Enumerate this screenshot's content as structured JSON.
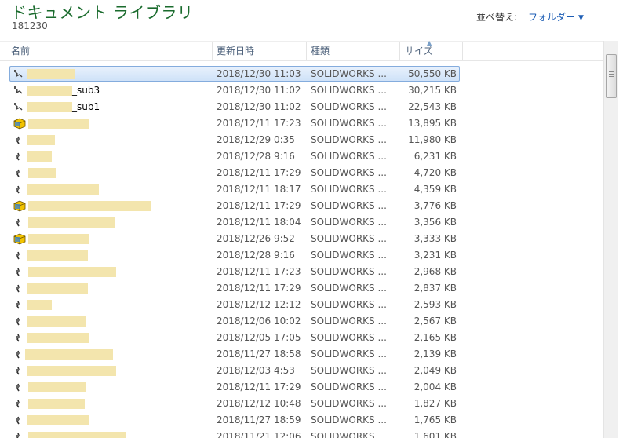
{
  "library": {
    "title": "ドキュメント ライブラリ",
    "subtitle": "181230",
    "arrange_label": "並べ替え:",
    "arrange_value": "フォルダー"
  },
  "columns": {
    "name": "名前",
    "date": "更新日時",
    "type": "種類",
    "size": "サイズ"
  },
  "files": [
    {
      "name_suffix": "",
      "date": "2018/12/30 11:03",
      "type": "SOLIDWORKS ...",
      "size": "50,550 KB",
      "icon": "assembly-icon",
      "selected": true
    },
    {
      "name_suffix": "_sub3",
      "date": "2018/12/30 11:02",
      "type": "SOLIDWORKS ...",
      "size": "30,215 KB",
      "icon": "assembly-icon"
    },
    {
      "name_suffix": "_sub1",
      "date": "2018/12/30 11:02",
      "type": "SOLIDWORKS ...",
      "size": "22,543 KB",
      "icon": "assembly-icon"
    },
    {
      "name_suffix": "",
      "date": "2018/12/11 17:23",
      "type": "SOLIDWORKS ...",
      "size": "13,895 KB",
      "icon": "solidworks-icon"
    },
    {
      "name_suffix": "",
      "date": "2018/12/29 0:35",
      "type": "SOLIDWORKS ...",
      "size": "11,980 KB",
      "icon": "part-icon"
    },
    {
      "name_suffix": "",
      "date": "2018/12/28 9:16",
      "type": "SOLIDWORKS ...",
      "size": "6,231 KB",
      "icon": "part-icon"
    },
    {
      "name_suffix": "",
      "date": "2018/12/11 17:29",
      "type": "SOLIDWORKS ...",
      "size": "4,720 KB",
      "icon": "part-icon"
    },
    {
      "name_suffix": "",
      "date": "2018/12/11 18:17",
      "type": "SOLIDWORKS ...",
      "size": "4,359 KB",
      "icon": "part-icon"
    },
    {
      "name_suffix": "",
      "date": "2018/12/11 17:29",
      "type": "SOLIDWORKS ...",
      "size": "3,776 KB",
      "icon": "solidworks-icon"
    },
    {
      "name_suffix": "",
      "date": "2018/12/11 18:04",
      "type": "SOLIDWORKS ...",
      "size": "3,356 KB",
      "icon": "part-icon"
    },
    {
      "name_suffix": "",
      "date": "2018/12/26 9:52",
      "type": "SOLIDWORKS ...",
      "size": "3,333 KB",
      "icon": "solidworks-icon"
    },
    {
      "name_suffix": "",
      "date": "2018/12/28 9:16",
      "type": "SOLIDWORKS ...",
      "size": "3,231 KB",
      "icon": "part-icon"
    },
    {
      "name_suffix": "",
      "date": "2018/12/11 17:23",
      "type": "SOLIDWORKS ...",
      "size": "2,968 KB",
      "icon": "part-icon"
    },
    {
      "name_suffix": "",
      "date": "2018/12/11 17:29",
      "type": "SOLIDWORKS ...",
      "size": "2,837 KB",
      "icon": "part-icon"
    },
    {
      "name_suffix": "",
      "date": "2018/12/12 12:12",
      "type": "SOLIDWORKS ...",
      "size": "2,593 KB",
      "icon": "part-icon"
    },
    {
      "name_suffix": "",
      "date": "2018/12/06 10:02",
      "type": "SOLIDWORKS ...",
      "size": "2,567 KB",
      "icon": "part-icon"
    },
    {
      "name_suffix": "",
      "date": "2018/12/05 17:05",
      "type": "SOLIDWORKS ...",
      "size": "2,165 KB",
      "icon": "part-icon"
    },
    {
      "name_suffix": "",
      "date": "2018/11/27 18:58",
      "type": "SOLIDWORKS ...",
      "size": "2,139 KB",
      "icon": "part-icon"
    },
    {
      "name_suffix": "",
      "date": "2018/12/03 4:53",
      "type": "SOLIDWORKS ...",
      "size": "2,049 KB",
      "icon": "part-icon"
    },
    {
      "name_suffix": "",
      "date": "2018/12/11 17:29",
      "type": "SOLIDWORKS ...",
      "size": "2,004 KB",
      "icon": "part-icon"
    },
    {
      "name_suffix": "",
      "date": "2018/12/12 10:48",
      "type": "SOLIDWORKS ...",
      "size": "1,827 KB",
      "icon": "part-icon"
    },
    {
      "name_suffix": "",
      "date": "2018/11/27 18:59",
      "type": "SOLIDWORKS ...",
      "size": "1,765 KB",
      "icon": "part-icon"
    },
    {
      "name_suffix": "",
      "date": "2018/11/21 12:06",
      "type": "SOLIDWORKS ...",
      "size": "1,601 KB",
      "icon": "part-icon"
    }
  ],
  "colors": {
    "title": "#1a6b2d",
    "link": "#1e5eb5",
    "selection_border": "#84acdd",
    "redaction": "#f3e5ad"
  }
}
